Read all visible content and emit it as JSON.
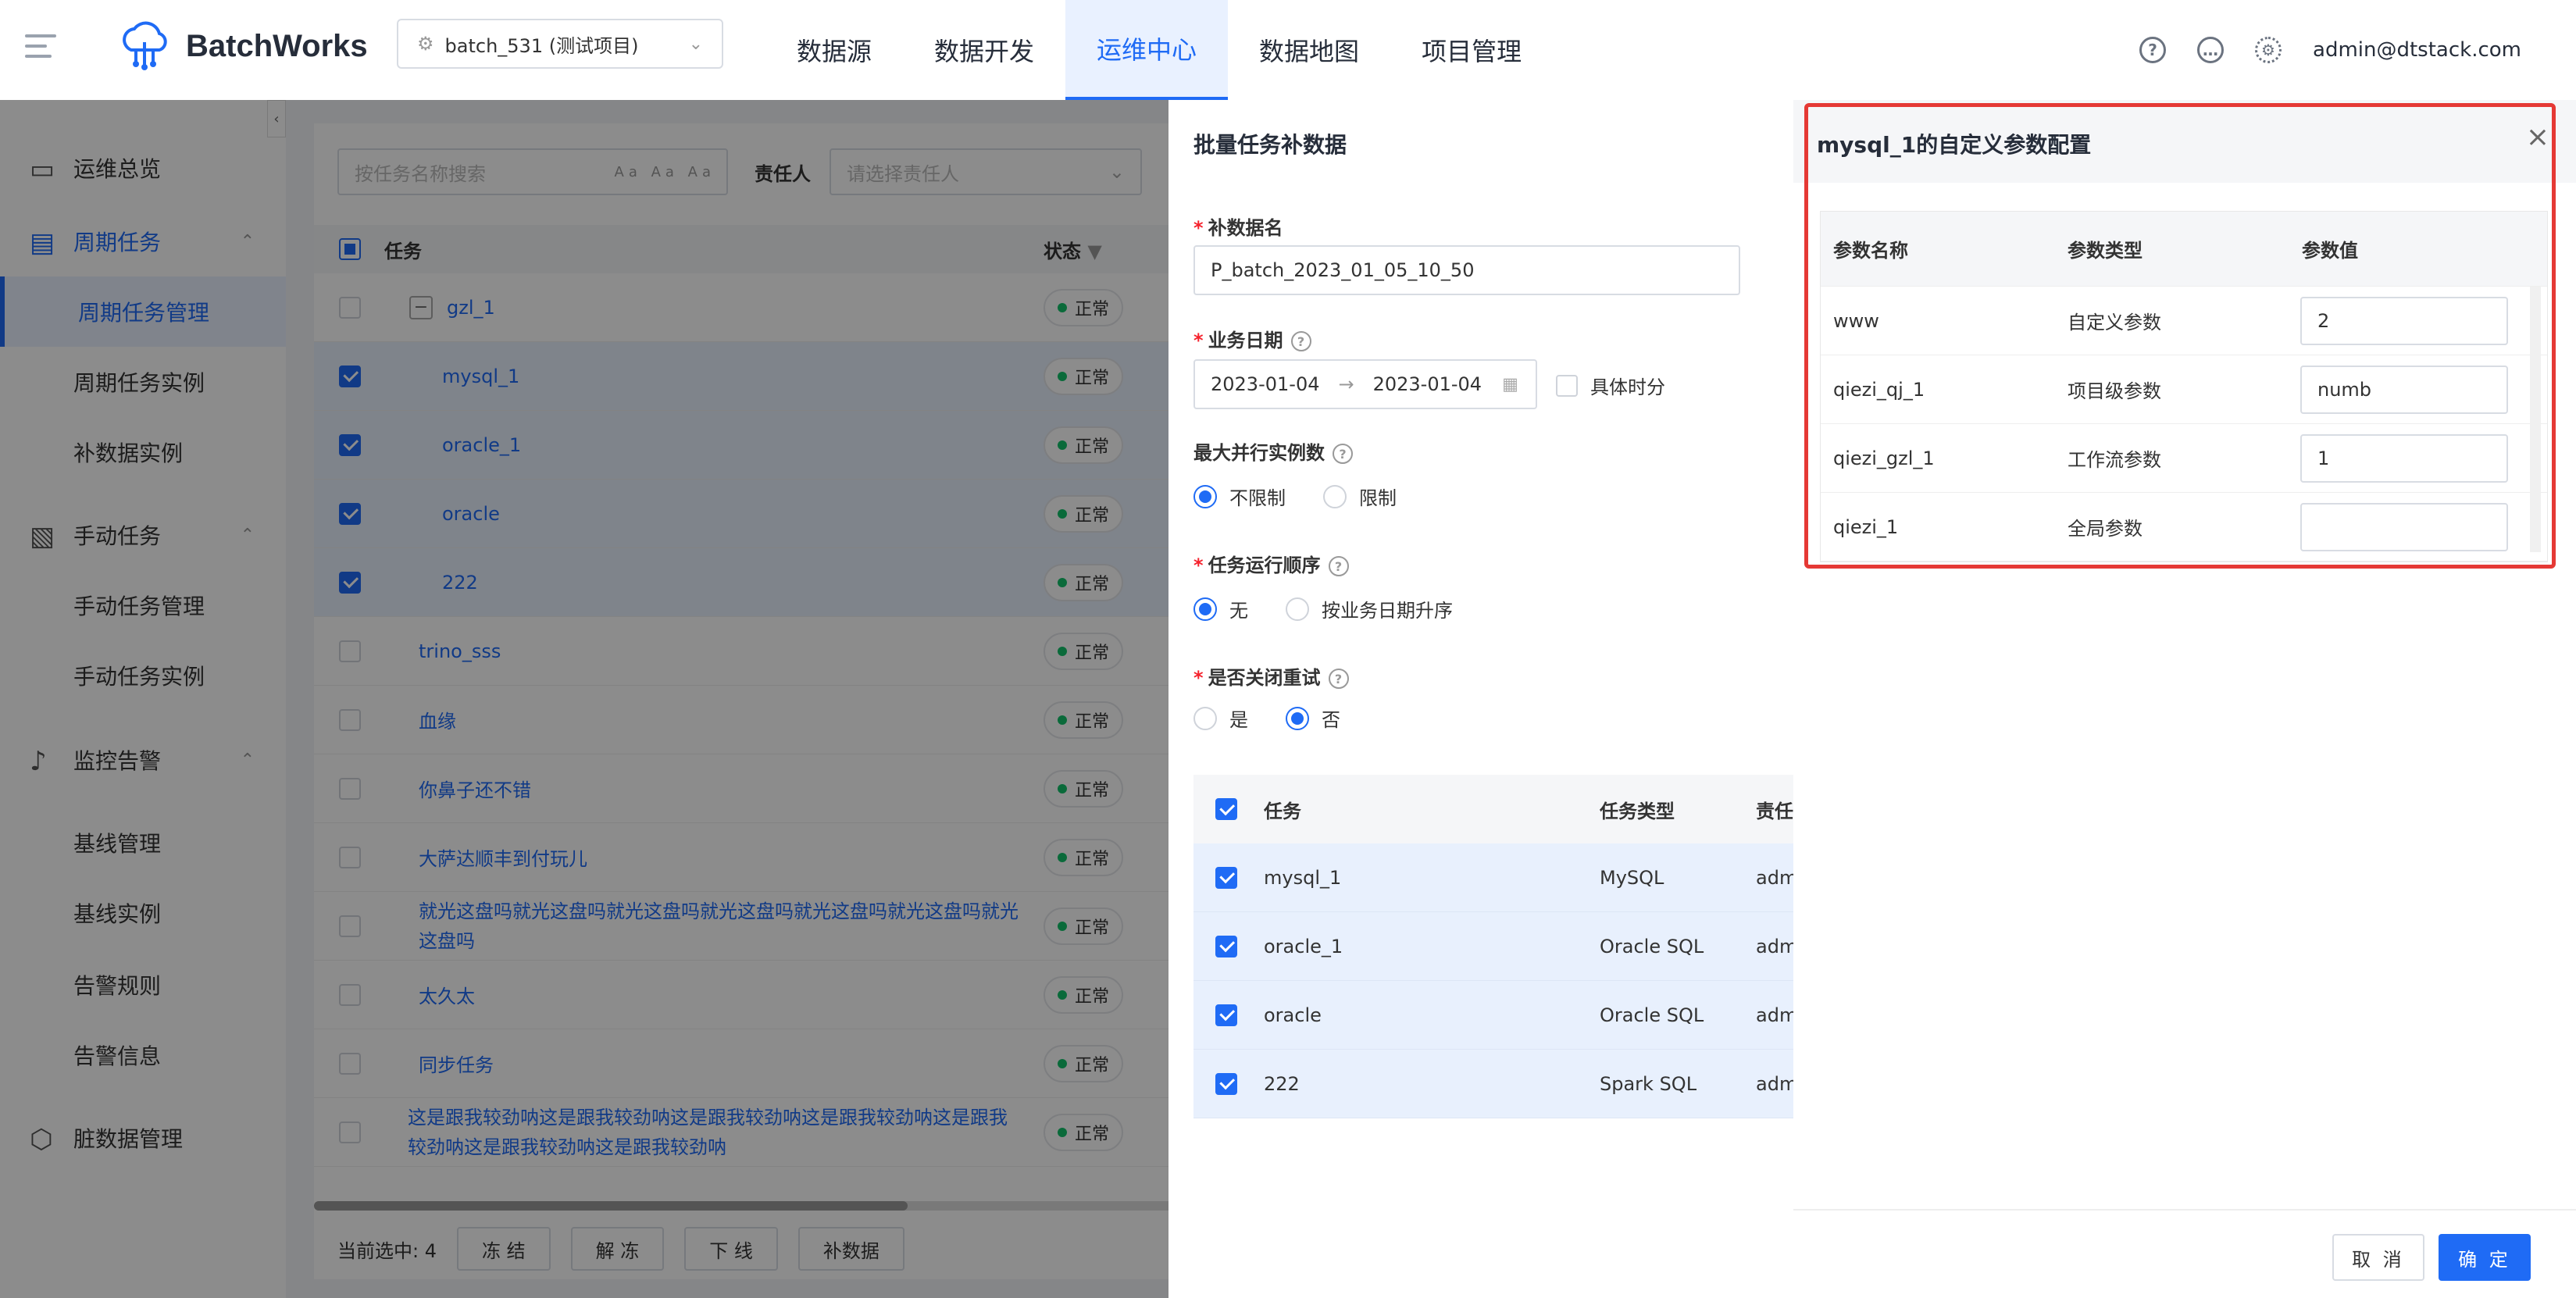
{
  "header": {
    "app_name": "BatchWorks",
    "project": "batch_531 (测试项目)",
    "nav": [
      "数据源",
      "数据开发",
      "运维中心",
      "数据地图",
      "项目管理"
    ],
    "active_nav": 2,
    "user": "admin@dtstack.com"
  },
  "sidebar": {
    "items": [
      {
        "label": "运维总览",
        "type": "group"
      },
      {
        "label": "周期任务",
        "type": "group-active"
      },
      {
        "label": "周期任务管理",
        "type": "sub-selected"
      },
      {
        "label": "周期任务实例",
        "type": "sub"
      },
      {
        "label": "补数据实例",
        "type": "sub"
      },
      {
        "label": "手动任务",
        "type": "group"
      },
      {
        "label": "手动任务管理",
        "type": "sub"
      },
      {
        "label": "手动任务实例",
        "type": "sub"
      },
      {
        "label": "监控告警",
        "type": "group"
      },
      {
        "label": "基线管理",
        "type": "sub"
      },
      {
        "label": "基线实例",
        "type": "sub"
      },
      {
        "label": "告警规则",
        "type": "sub"
      },
      {
        "label": "告警信息",
        "type": "sub"
      },
      {
        "label": "脏数据管理",
        "type": "group"
      }
    ]
  },
  "task_list": {
    "search_placeholder": "按任务名称搜索",
    "owner_label": "责任人",
    "owner_placeholder": "请选择责任人",
    "col_task": "任务",
    "col_status": "状态",
    "status_text": "正常",
    "rows": [
      {
        "name": "gzl_1",
        "checked": false,
        "level": 0
      },
      {
        "name": "mysql_1",
        "checked": true,
        "level": 1
      },
      {
        "name": "oracle_1",
        "checked": true,
        "level": 1
      },
      {
        "name": "oracle",
        "checked": true,
        "level": 1
      },
      {
        "name": "222",
        "checked": true,
        "level": 1
      },
      {
        "name": "trino_sss",
        "checked": false,
        "level": 0
      },
      {
        "name": "血缘",
        "checked": false,
        "level": 0
      },
      {
        "name": "你鼻子还不错",
        "checked": false,
        "level": 0
      },
      {
        "name": "大萨达顺丰到付玩儿",
        "checked": false,
        "level": 0
      },
      {
        "name": "就光这盘吗就光这盘吗就光这盘吗就光这盘吗就光这盘吗就光这盘吗就光这盘吗",
        "checked": false,
        "level": 0
      },
      {
        "name": "太久太",
        "checked": false,
        "level": 0
      },
      {
        "name": "同步任务",
        "checked": false,
        "level": 0
      },
      {
        "name": "这是跟我较劲呐这是跟我较劲呐这是跟我较劲呐这是跟我较劲呐这是跟我较劲呐这是跟我较劲呐这是跟我较劲呐",
        "checked": false,
        "level": 0
      }
    ],
    "footer": {
      "selected_text": "当前选中: 4",
      "buttons": [
        "冻 结",
        "解 冻",
        "下 线",
        "补数据"
      ]
    }
  },
  "patch_drawer": {
    "title": "批量任务补数据",
    "name_label": "补数据名",
    "name_value": "P_batch_2023_01_05_10_50",
    "date_label": "业务日期",
    "date_start": "2023-01-04",
    "date_end": "2023-01-04",
    "specific_time": "具体时分",
    "max_parallel_label": "最大并行实例数",
    "max_parallel_options": [
      "不限制",
      "限制"
    ],
    "order_label": "任务运行顺序",
    "order_options": [
      "无",
      "按业务日期升序"
    ],
    "retry_label": "是否关闭重试",
    "retry_options": [
      "是",
      "否"
    ],
    "table_headers": [
      "任务",
      "任务类型",
      "责任"
    ],
    "table_rows": [
      {
        "task": "mysql_1",
        "type": "MySQL",
        "owner": "adm"
      },
      {
        "task": "oracle_1",
        "type": "Oracle SQL",
        "owner": "adm"
      },
      {
        "task": "oracle",
        "type": "Oracle SQL",
        "owner": "adm"
      },
      {
        "task": "222",
        "type": "Spark SQL",
        "owner": "adm"
      }
    ]
  },
  "param_panel": {
    "title": "mysql_1的自定义参数配置",
    "headers": [
      "参数名称",
      "参数类型",
      "参数值"
    ],
    "rows": [
      {
        "name": "www",
        "type": "自定义参数",
        "value": "2"
      },
      {
        "name": "qiezi_qj_1",
        "type": "项目级参数",
        "value": "numb"
      },
      {
        "name": "qiezi_gzl_1",
        "type": "工作流参数",
        "value": "1"
      },
      {
        "name": "qiezi_1",
        "type": "全局参数",
        "value": ""
      }
    ],
    "cancel": "取 消",
    "ok": "确 定"
  },
  "colors": {
    "primary": "#1f6bf5",
    "highlight": "#e53935",
    "status_ok": "#13c26b"
  }
}
